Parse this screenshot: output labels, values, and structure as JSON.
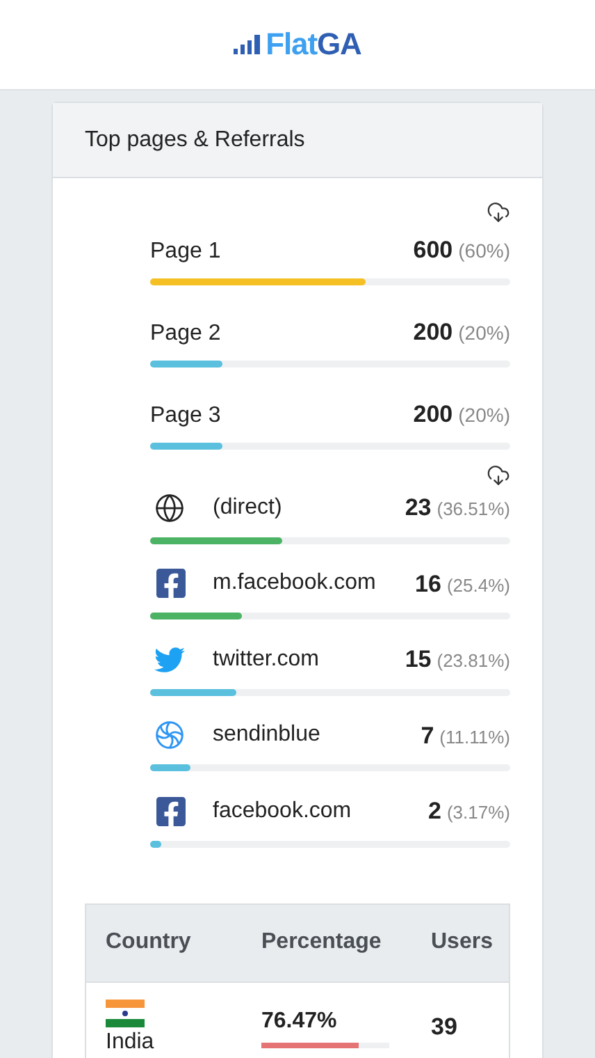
{
  "header": {
    "logo": [
      "Flat",
      "GA"
    ]
  },
  "card": {
    "title": "Top pages & Referrals"
  },
  "pages": [
    {
      "label": "Page 1",
      "count": "600",
      "percent": "(60%)",
      "level": 0.6,
      "color": "#f5c024"
    },
    {
      "label": "Page 2",
      "count": "200",
      "percent": "(20%)",
      "level": 0.2,
      "color": "#5bc0de"
    },
    {
      "label": "Page 3",
      "count": "200",
      "percent": "(20%)",
      "level": 0.2,
      "color": "#5bc0de"
    }
  ],
  "referrals": [
    {
      "kind": "globe",
      "label": "(direct)",
      "count": "23",
      "percent": "(36.51%)",
      "level": 0.3651,
      "color": "#4cb364"
    },
    {
      "kind": "facebook",
      "label": "m.facebook.com",
      "count": "16",
      "percent": "(25.4%)",
      "level": 0.254,
      "color": "#4cb364"
    },
    {
      "kind": "twitter",
      "label": "twitter.com",
      "count": "15",
      "percent": "(23.81%)",
      "level": 0.2381,
      "color": "#5bc0de"
    },
    {
      "kind": "sendinblue",
      "label": "sendinblue",
      "count": "7",
      "percent": "(11.11%)",
      "level": 0.1111,
      "color": "#5bc0de"
    },
    {
      "kind": "facebook",
      "label": "facebook.com",
      "count": "2",
      "percent": "(3.17%)",
      "level": 0.0317,
      "color": "#5bc0de"
    }
  ],
  "table": {
    "columns": [
      "Country",
      "Percentage",
      "Users"
    ],
    "rows": [
      {
        "country": "India",
        "percentage": "76.47%",
        "level": 0.7647,
        "users": "39"
      }
    ]
  }
}
